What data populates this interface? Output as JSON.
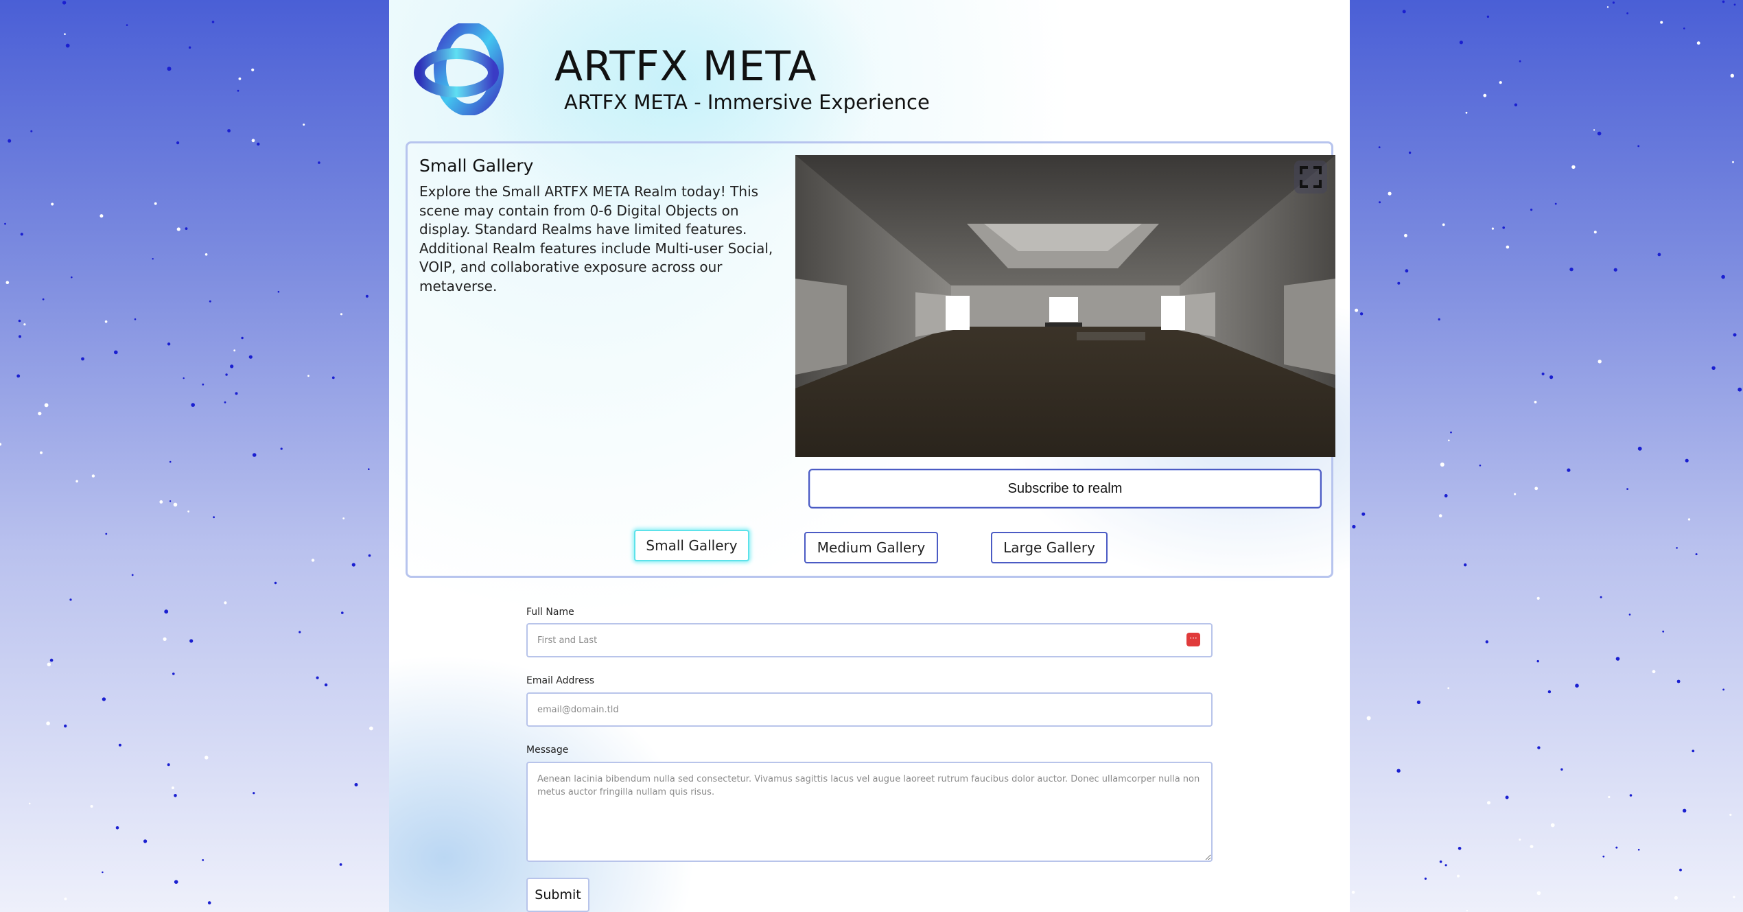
{
  "brand": {
    "title": "ARTFX META",
    "subtitle": "ARTFX META - Immersive Experience"
  },
  "gallery": {
    "title": "Small Gallery",
    "description": "Explore the Small ARTFX META Realm today! This scene may contain from 0-6 Digital Objects on display. Standard Realms have limited features. Additional Realm features include Multi-user Social, VOIP, and collaborative exposure across our metaverse.",
    "subscribe_label": "Subscribe to realm",
    "fullscreen_icon": "fullscreen-icon",
    "tabs": [
      {
        "label": "Small Gallery",
        "active": true
      },
      {
        "label": "Medium Gallery",
        "active": false
      },
      {
        "label": "Large Gallery",
        "active": false
      }
    ]
  },
  "form": {
    "full_name_label": "Full Name",
    "full_name_placeholder": "First and Last",
    "email_label": "Email Address",
    "email_placeholder": "email@domain.tld",
    "message_label": "Message",
    "message_placeholder": "Aenean lacinia bibendum nulla sed consectetur. Vivamus sagittis lacus vel augue laoreet rutrum faucibus dolor auctor. Donec ullamcorper nulla non metus auctor fringilla nullam quis risus.",
    "submit_label": "Submit"
  },
  "colors": {
    "accent": "#4b5bc4",
    "active_tab": "#5de2ea",
    "background_top": "#4a5fd6"
  }
}
